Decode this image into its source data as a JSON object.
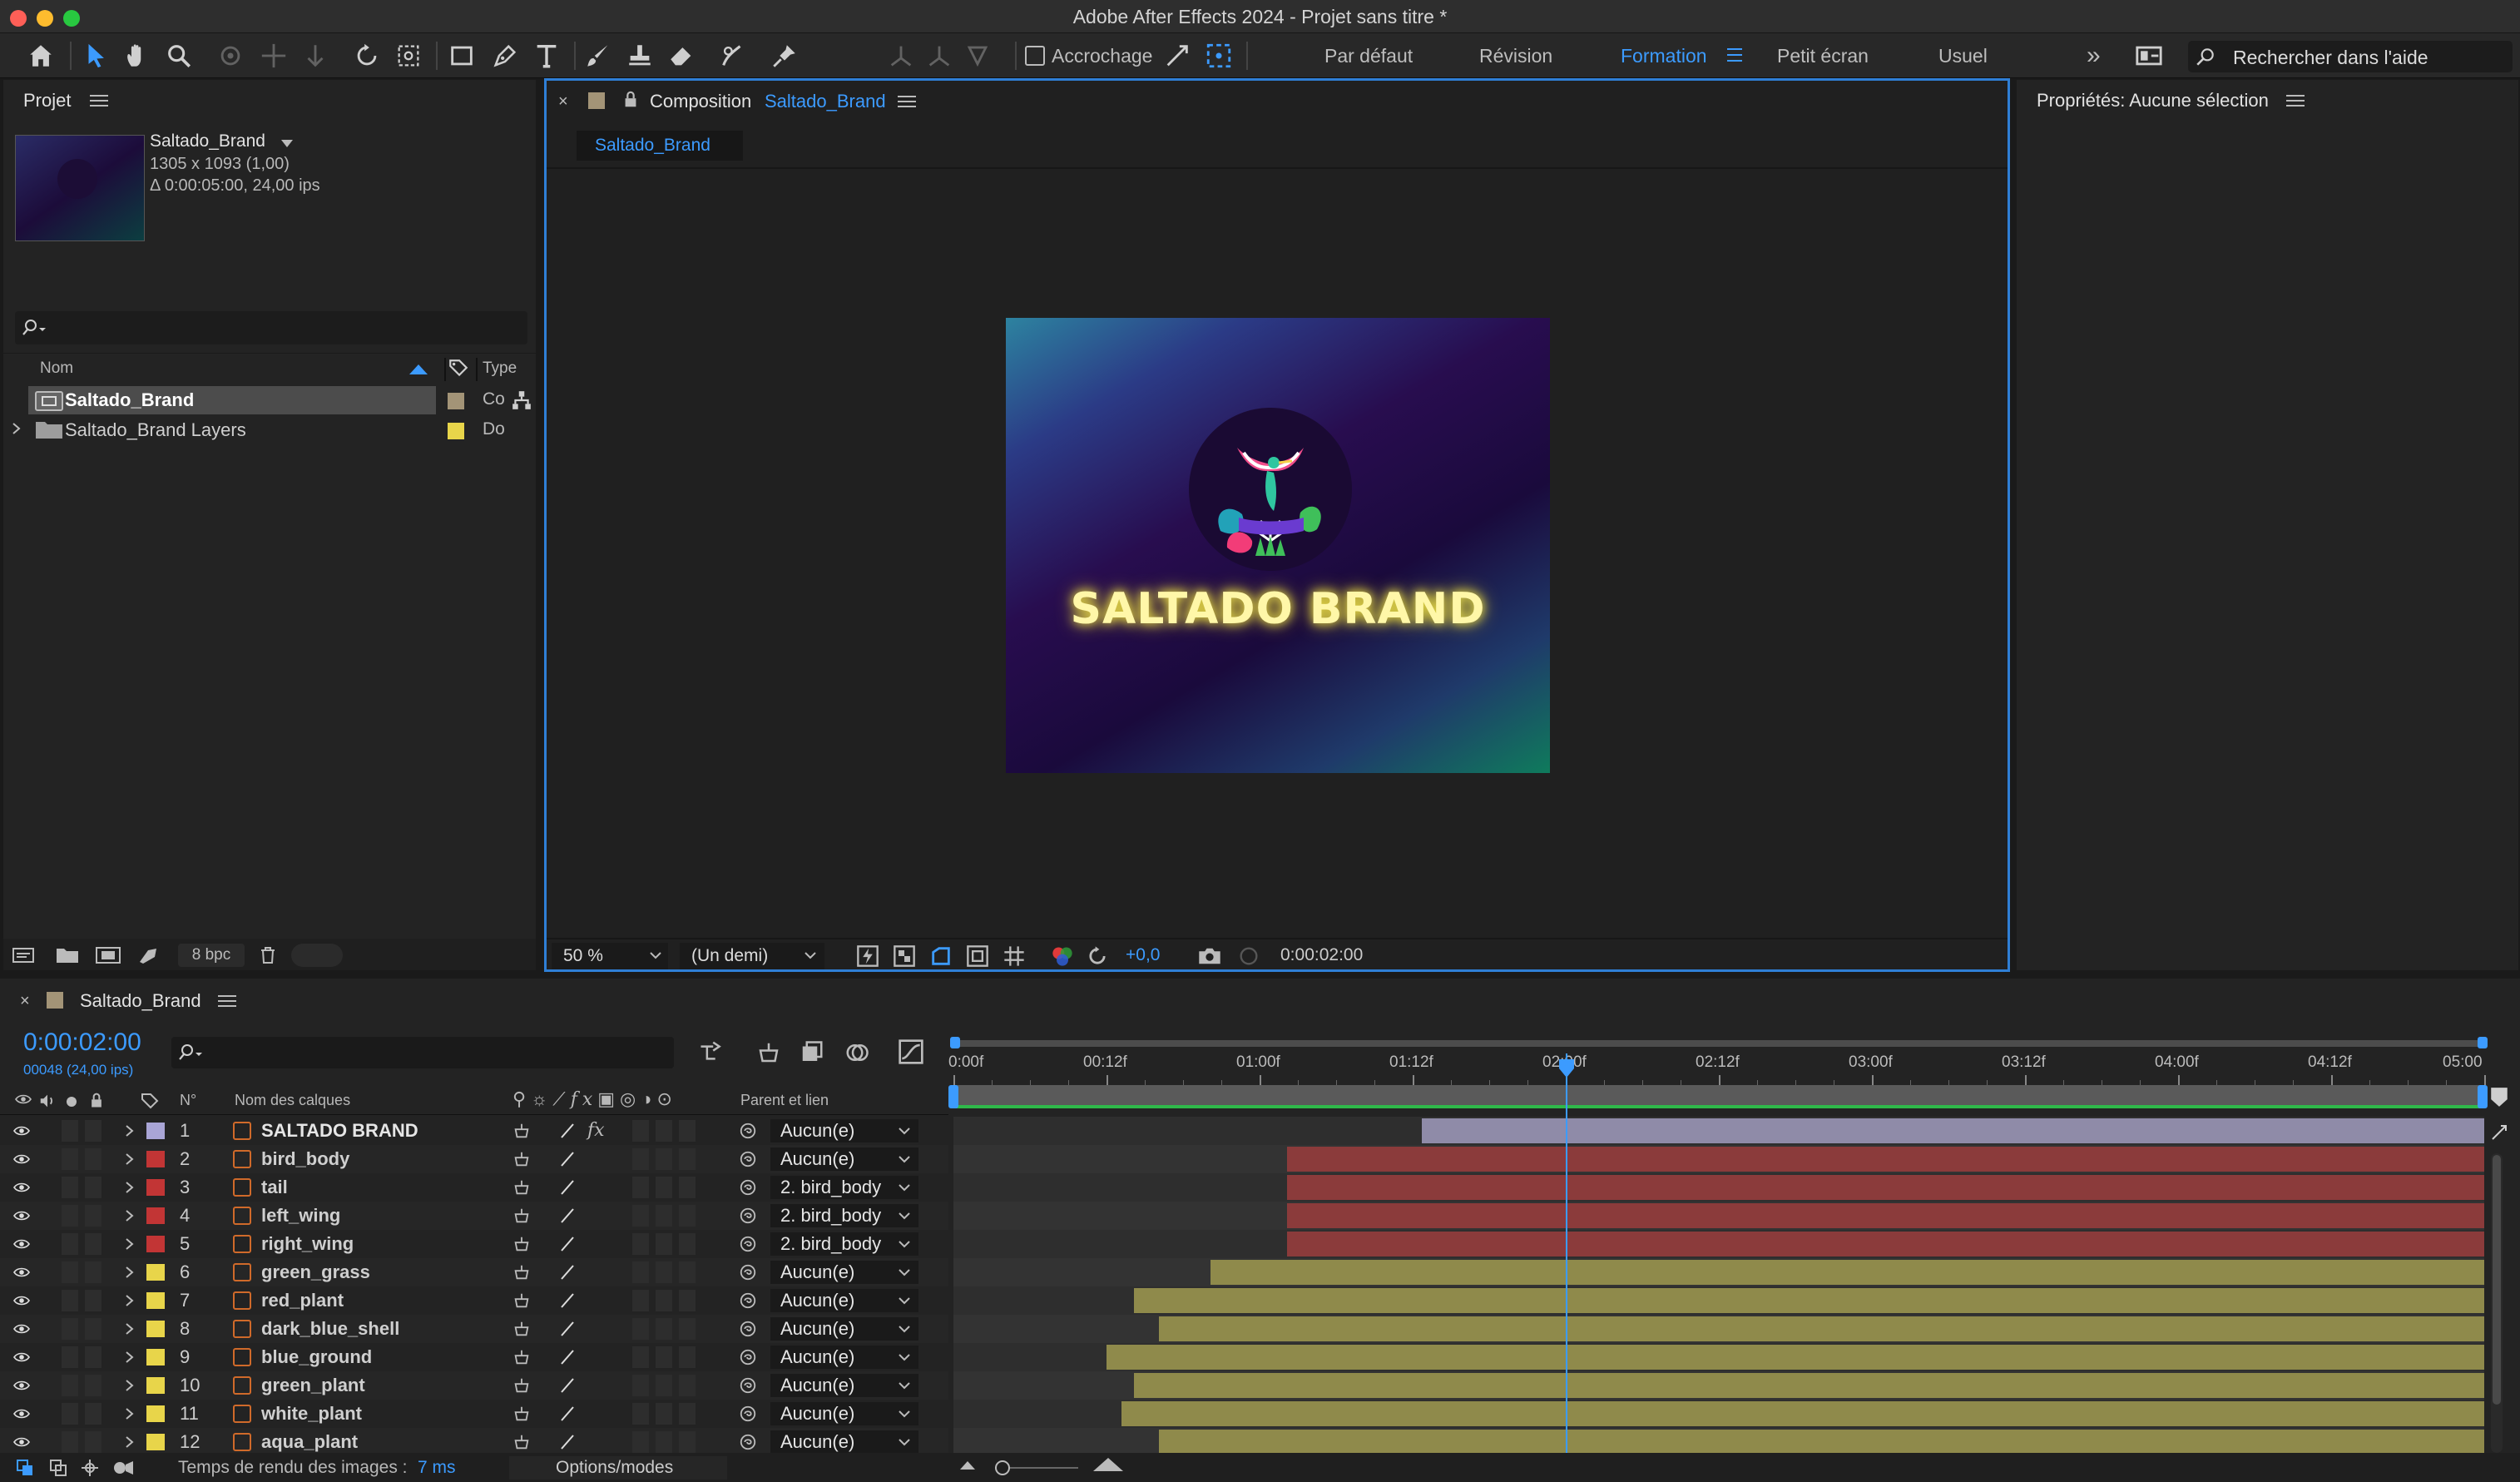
{
  "window": {
    "title": "Adobe After Effects 2024 - Projet sans titre *"
  },
  "toolbar": {
    "tools": [
      "home-icon",
      "selection-tool-icon",
      "hand-tool-icon",
      "zoom-tool-icon",
      "orbit-camera-icon",
      "pan-camera-icon",
      "dolly-camera-icon",
      "rotation-tool-icon",
      "anchor-point-tool-icon",
      "rectangle-tool-icon",
      "pen-tool-icon",
      "type-tool-icon",
      "brush-tool-icon",
      "clone-stamp-icon",
      "eraser-tool-icon",
      "roto-brush-icon",
      "puppet-pin-icon"
    ],
    "snapping_label": "Accrochage",
    "workspaces": [
      "Par défaut",
      "Révision",
      "Formation",
      "Petit écran",
      "Usuel"
    ],
    "active_workspace": "Formation",
    "help_search_placeholder": "Rechercher dans l'aide"
  },
  "project": {
    "panel_title": "Projet",
    "item_name": "Saltado_Brand",
    "item_dimensions": "1305 x 1093 (1,00)",
    "item_duration": "Δ 0:00:05:00, 24,00 ips",
    "col_name": "Nom",
    "col_type": "Type",
    "items": [
      {
        "name": "Saltado_Brand",
        "type": "Co",
        "label_color": "#a39477"
      },
      {
        "name": "Saltado_Brand Layers",
        "type": "Do",
        "label_color": "#e8d54a"
      }
    ],
    "bit_depth": "8 bpc"
  },
  "composition": {
    "tab_prefix": "Composition",
    "tab_name": "Saltado_Brand",
    "sub_tab": "Saltado_Brand",
    "brand_text": "SALTADO BRAND",
    "zoom": "50 %",
    "resolution": "(Un demi)",
    "exposure": "+0,0",
    "timecode": "0:00:02:00"
  },
  "properties": {
    "title": "Propriétés: Aucune sélection"
  },
  "timeline": {
    "tab_name": "Saltado_Brand",
    "current_time": "0:00:02:00",
    "frame_info": "00048 (24,00 ips)",
    "col_num": "N°",
    "col_layer_name": "Nom des calques",
    "col_parent": "Parent et lien",
    "ruler_labels": [
      "0:00f",
      "00:12f",
      "01:00f",
      "01:12f",
      "02:00f",
      "02:12f",
      "03:00f",
      "03:12f",
      "04:00f",
      "04:12f",
      "05:00"
    ],
    "playhead_seconds": 2.0,
    "duration_seconds": 5.0,
    "layers": [
      {
        "num": "1",
        "name": "SALTADO BRAND",
        "color": "#a9a5d6",
        "parent": "Aucun(e)",
        "in": 1.53,
        "bar": "#8f8ba8",
        "fx": true
      },
      {
        "num": "2",
        "name": "bird_body",
        "color": "#c23535",
        "parent": "Aucun(e)",
        "in": 1.09,
        "bar": "#8b3b3b"
      },
      {
        "num": "3",
        "name": "tail",
        "color": "#c23535",
        "parent": "2. bird_body",
        "in": 1.09,
        "bar": "#8b3b3b"
      },
      {
        "num": "4",
        "name": "left_wing",
        "color": "#c23535",
        "parent": "2. bird_body",
        "in": 1.09,
        "bar": "#8b3b3b"
      },
      {
        "num": "5",
        "name": "right_wing",
        "color": "#c23535",
        "parent": "2. bird_body",
        "in": 1.09,
        "bar": "#8b3b3b"
      },
      {
        "num": "6",
        "name": "green_grass",
        "color": "#e8d54a",
        "parent": "Aucun(e)",
        "in": 0.84,
        "bar": "#8f8a4b"
      },
      {
        "num": "7",
        "name": "red_plant",
        "color": "#e8d54a",
        "parent": "Aucun(e)",
        "in": 0.59,
        "bar": "#8f8a4b"
      },
      {
        "num": "8",
        "name": "dark_blue_shell",
        "color": "#e8d54a",
        "parent": "Aucun(e)",
        "in": 0.67,
        "bar": "#8f8a4b"
      },
      {
        "num": "9",
        "name": "blue_ground",
        "color": "#e8d54a",
        "parent": "Aucun(e)",
        "in": 0.5,
        "bar": "#8f8a4b"
      },
      {
        "num": "10",
        "name": "green_plant",
        "color": "#e8d54a",
        "parent": "Aucun(e)",
        "in": 0.59,
        "bar": "#8f8a4b"
      },
      {
        "num": "11",
        "name": "white_plant",
        "color": "#e8d54a",
        "parent": "Aucun(e)",
        "in": 0.55,
        "bar": "#8f8a4b"
      },
      {
        "num": "12",
        "name": "aqua_plant",
        "color": "#e8d54a",
        "parent": "Aucun(e)",
        "in": 0.67,
        "bar": "#8f8a4b"
      }
    ],
    "render_label": "Temps de rendu des images : ",
    "render_value": "7 ms",
    "options_modes": "Options/modes"
  },
  "colors": {
    "accent": "#3c9bff",
    "work_area": "#2fb84a"
  }
}
